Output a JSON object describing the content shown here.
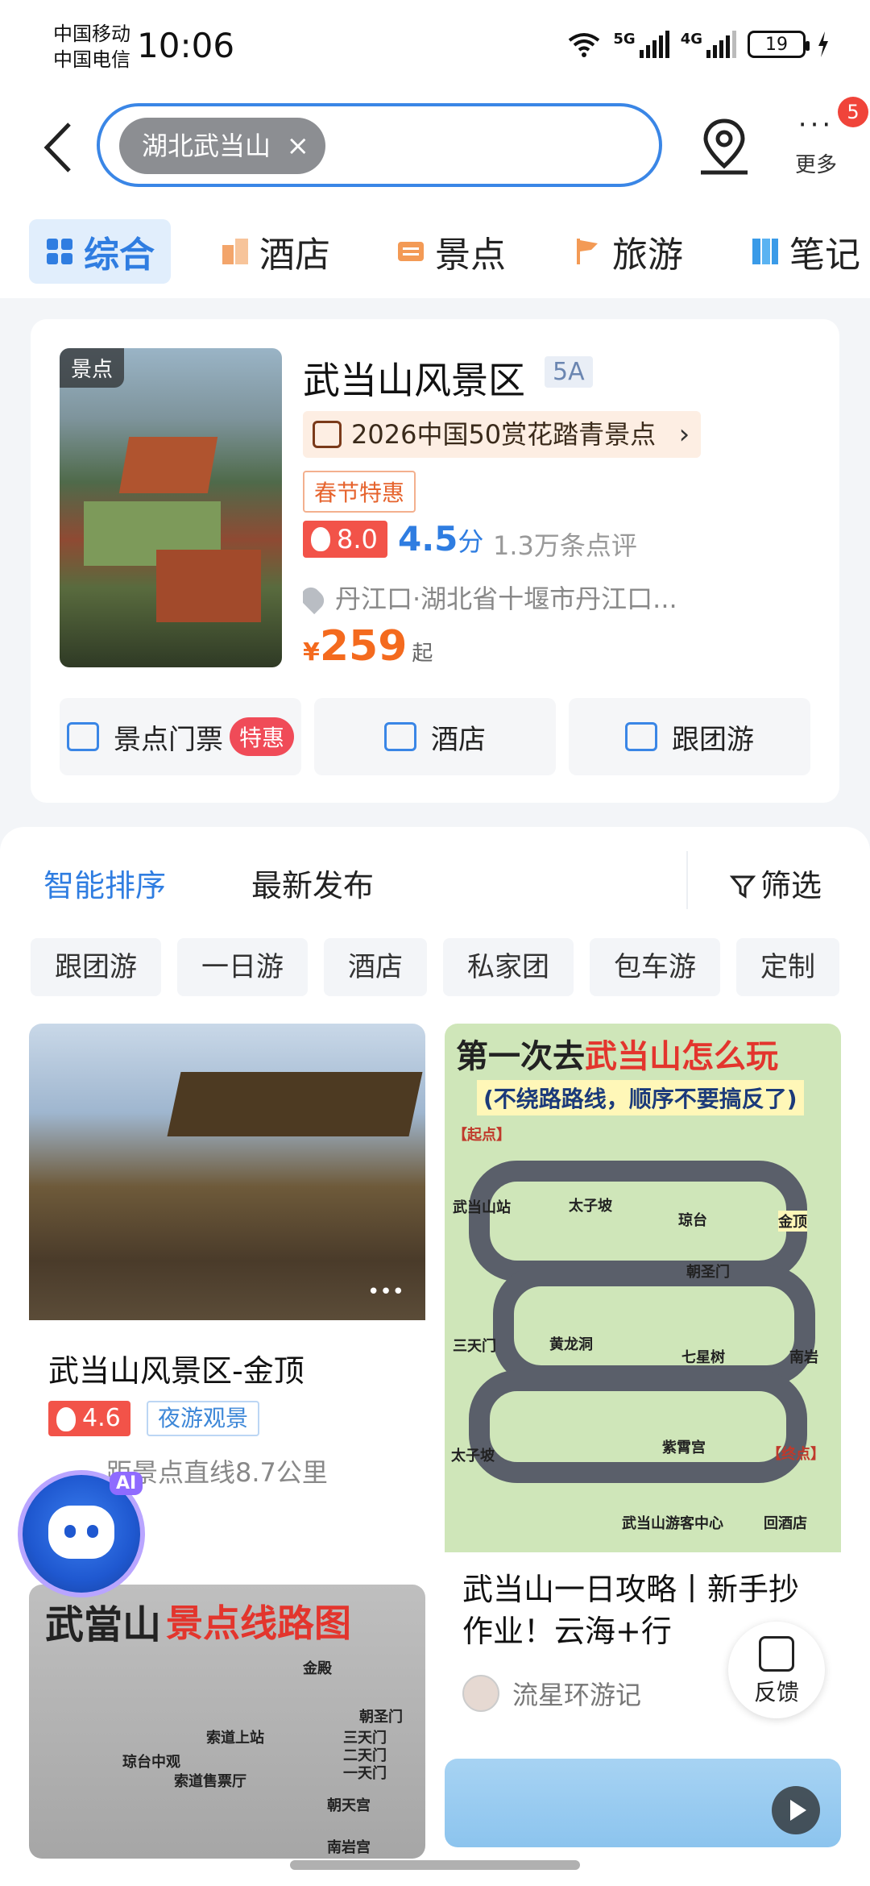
{
  "status": {
    "carrier1": "中国移动",
    "carrier2": "中国电信",
    "time": "10:06",
    "net1": "5G",
    "net2": "4G",
    "battery": "19"
  },
  "search": {
    "query_chip": "湖北武当山",
    "more_label": "更多",
    "more_badge": "5"
  },
  "tabs": [
    {
      "label": "综合"
    },
    {
      "label": "酒店"
    },
    {
      "label": "景点"
    },
    {
      "label": "旅游"
    },
    {
      "label": "笔记"
    }
  ],
  "spot": {
    "thumb_tag": "景点",
    "title": "武当山风景区",
    "level": "5A",
    "award": "2026中国50赏花踏青景点",
    "promo": "春节特惠",
    "heat": "8.0",
    "score": "4.5",
    "score_unit": "分",
    "reviews": "1.3万条点评",
    "address": "丹江口·湖北省十堰市丹江口...",
    "price_currency": "¥",
    "price": "259",
    "price_suffix": "起",
    "quick": [
      {
        "label": "景点门票",
        "badge": "特惠"
      },
      {
        "label": "酒店"
      },
      {
        "label": "跟团游"
      }
    ]
  },
  "feed": {
    "sort_active": "智能排序",
    "sort_latest": "最新发布",
    "filter": "筛选",
    "chips": [
      "跟团游",
      "一日游",
      "酒店",
      "私家团",
      "包车游",
      "定制"
    ],
    "card1": {
      "title": "武当山风景区-金顶",
      "heat": "4.6",
      "tag": "夜游观景",
      "distance": "距景点直线8.7公里"
    },
    "card2": {
      "img_title_a": "第一次去",
      "img_title_b": "武当山怎么玩",
      "img_sub": "(不绕路路线，顺序不要搞反了)",
      "img_start": "【起点】",
      "img_end": "【终点】",
      "stops": [
        "武当山站",
        "太子坡",
        "琼台",
        "金顶",
        "朝圣门",
        "三天门",
        "黄龙洞",
        "七星树",
        "南岩",
        "紫霄宫",
        "武当山游客中心",
        "回酒店"
      ],
      "title": "武当山一日攻略丨新手抄作业！云海+行",
      "author": "流星环游记"
    },
    "card3": {
      "img_title_a": "武當山",
      "img_title_b": "景点线路图",
      "img_labels": [
        "金殿",
        "朝圣门",
        "三天门",
        "二天门",
        "一天门",
        "朝天宫",
        "琼台中观",
        "索道售票厅",
        "南岩宫",
        "索道上站"
      ]
    }
  },
  "ai_badge": "AI",
  "feedback_label": "反馈"
}
